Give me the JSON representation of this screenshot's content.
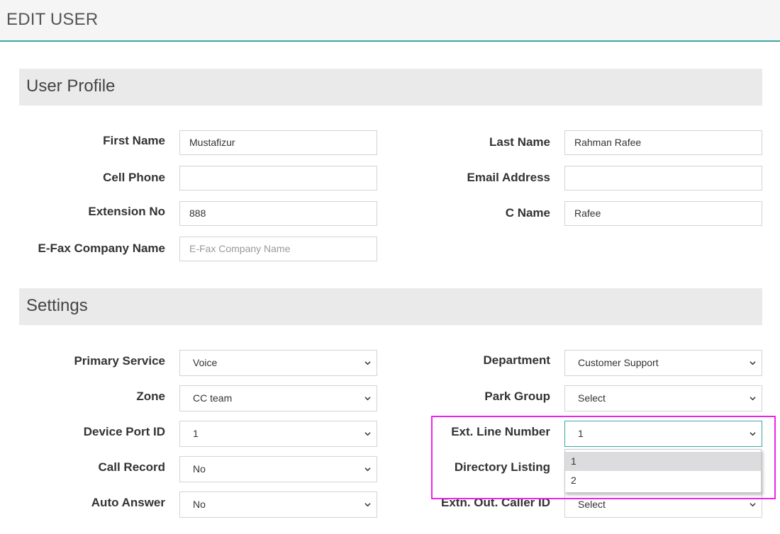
{
  "header": {
    "title": "EDIT USER"
  },
  "sections": {
    "profile": {
      "title": "User Profile"
    },
    "settings": {
      "title": "Settings"
    }
  },
  "profile": {
    "first_name": {
      "label": "First Name",
      "value": "Mustafizur"
    },
    "last_name": {
      "label": "Last Name",
      "value": "Rahman Rafee"
    },
    "cell_phone": {
      "label": "Cell Phone",
      "value": ""
    },
    "email": {
      "label": "Email Address",
      "value": ""
    },
    "extension": {
      "label": "Extension No",
      "value": "888"
    },
    "c_name": {
      "label": "C Name",
      "value": "Rafee"
    },
    "efax": {
      "label": "E-Fax Company Name",
      "value": "",
      "placeholder": "E-Fax Company Name"
    }
  },
  "settings": {
    "primary_service": {
      "label": "Primary Service",
      "value": "Voice"
    },
    "department": {
      "label": "Department",
      "value": "Customer Support"
    },
    "zone": {
      "label": "Zone",
      "value": "CC team"
    },
    "park_group": {
      "label": "Park Group",
      "value": "Select"
    },
    "device_port": {
      "label": "Device Port ID",
      "value": "1"
    },
    "ext_line": {
      "label": "Ext. Line Number",
      "value": "1",
      "options": [
        "1",
        "2"
      ]
    },
    "call_record": {
      "label": "Call Record",
      "value": "No"
    },
    "directory_listing": {
      "label": "Directory Listing"
    },
    "auto_answer": {
      "label": "Auto Answer",
      "value": "No"
    },
    "extn_caller_id": {
      "label": "Extn. Out. Caller ID",
      "value": "Select"
    }
  },
  "colors": {
    "accent": "#3aa8a4",
    "highlight": "#ee22ee",
    "section_bg": "#eaeaea"
  },
  "icons": {
    "select_arrow": "chevron-down-icon"
  }
}
